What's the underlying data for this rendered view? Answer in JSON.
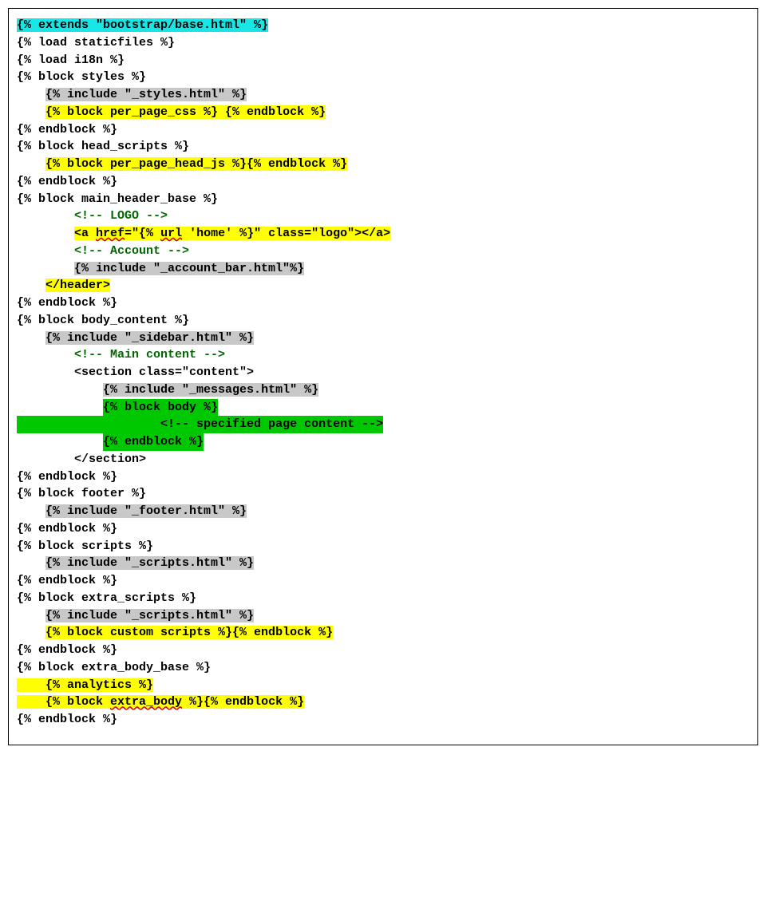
{
  "code": {
    "l01": "{% extends \"bootstrap/base.html\" %}",
    "l02": "",
    "l03": "{% load staticfiles %}",
    "l04": "{% load i18n %}",
    "l05": "",
    "l06": "{% block styles %}",
    "l07a": "    ",
    "l07b": "{% include \"_styles.html\" %}",
    "l08a": "    ",
    "l08b": "{% block per_page_css %} {% endblock %}",
    "l09": "{% endblock %}",
    "l10": "",
    "l11": "{% block head_scripts %}",
    "l12a": "    ",
    "l12b": "{% block per_page_head_js %}{% endblock %}",
    "l13": "{% endblock %}",
    "l14": "",
    "l15": "{% block main_header_base %}",
    "l16a": "        ",
    "l16b": "<!-- LOGO -->",
    "l17a": "        ",
    "l17b": "<a ",
    "l17c": "href",
    "l17d": "=\"{% ",
    "l17e": "url",
    "l17f": " 'home' %}\" class=\"logo\"></a>",
    "l18a": "        ",
    "l18b": "<!-- Account -->",
    "l19a": "        ",
    "l19b": "{% include \"_account_bar.html\"%}",
    "l20a": "    ",
    "l20b": "</header>",
    "l21": "{% endblock %}",
    "l22": "",
    "l23": "{% block body_content %}",
    "l24a": "    ",
    "l24b": "{% include \"_sidebar.html\" %}",
    "l25a": "        ",
    "l25b": "<!-- Main content -->",
    "l26": "        <section class=\"content\">",
    "l27a": "            ",
    "l27b": "{% include \"_messages.html\" %}",
    "l28a": "            ",
    "l28b": "{% block body %}",
    "l29a": "    ",
    "l29b": "                <!-- specified page content -->",
    "l30a": "            ",
    "l30b": "{% endblock %}",
    "l31": "        </section>",
    "l32": "{% endblock %}",
    "l33": "",
    "l34": "{% block footer %}",
    "l35a": "    ",
    "l35b": "{% include \"_footer.html\" %}",
    "l36": "{% endblock %}",
    "l37": "",
    "l38": "{% block scripts %}",
    "l39a": "    ",
    "l39b": "{% include \"_scripts.html\" %}",
    "l40": "{% endblock %}",
    "l41": "",
    "l42": "{% block extra_scripts %}",
    "l43a": "    ",
    "l43b": "{% include \"_scripts.html\" %}",
    "l44a": "    ",
    "l44b": "{% block custom scripts %}{% endblock %}",
    "l45": "{% endblock %}",
    "l46": "",
    "l47": "{% block extra_body_base %}",
    "l48a": "    ",
    "l48b": "{% analytics %}",
    "l49a": "    ",
    "l49b": "{% block ",
    "l49c": "extra_body",
    "l49d": " %}{% endblock %}",
    "l50": "{% endblock %}"
  }
}
